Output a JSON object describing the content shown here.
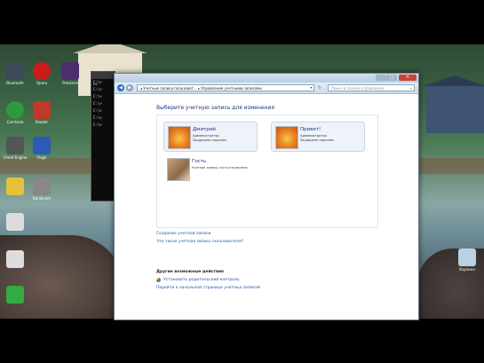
{
  "desktop_icons": [
    {
      "label": "Bluetooth",
      "color": "#3c4a5a"
    },
    {
      "label": "Opera",
      "color": "#cc1b1b"
    },
    {
      "label": "Premiere",
      "color": "#4a2e6e"
    },
    {
      "label": "Camtasia",
      "color": "#2c9b3a"
    },
    {
      "label": "Reader",
      "color": "#c0392b"
    },
    {
      "label": "Cheat Engine",
      "color": "#555555"
    },
    {
      "label": "Flags",
      "color": "#2b5cb5"
    },
    {
      "label": "",
      "color": "#e5c03a"
    },
    {
      "label": "Bandicam",
      "color": "#888888"
    },
    {
      "label": "",
      "color": "#dddddd"
    },
    {
      "label": "",
      "color": "#dddddd"
    },
    {
      "label": "",
      "color": "#33aa44"
    },
    {
      "label": "Корзина",
      "color": "#bcd0e0"
    }
  ],
  "cmd": {
    "lines": [
      "Lo",
      "C:\\>",
      "C:\\>",
      "C:\\>",
      "C:\\>",
      "C:\\>",
      "C:\\>",
      "C:\\>"
    ]
  },
  "window": {
    "address_path": "◂ Учетные записи пользоват... ▸ Управление учетными записями",
    "search_placeholder": "Поиск в панели управления",
    "heading": "Выберите учетную запись для изменения",
    "accounts": [
      {
        "name": "Дмитрий",
        "line1": "Администратор",
        "line2": "Защищено паролем",
        "type": "admin"
      },
      {
        "name": "Привет!",
        "line1": "Администратор",
        "line2": "Защищено паролем",
        "type": "admin"
      },
      {
        "name": "Гость",
        "line1": "Учетная запись гостя отключена",
        "line2": "",
        "type": "guest"
      }
    ],
    "create_link": "Создание учетной записи",
    "what_is_link": "Что такое учетная запись пользователя?",
    "other_actions_heading": "Другие возможные действия",
    "parental_controls_link": "Установить родительский контроль",
    "back_link": "Перейти к начальной странице учетных записей"
  }
}
